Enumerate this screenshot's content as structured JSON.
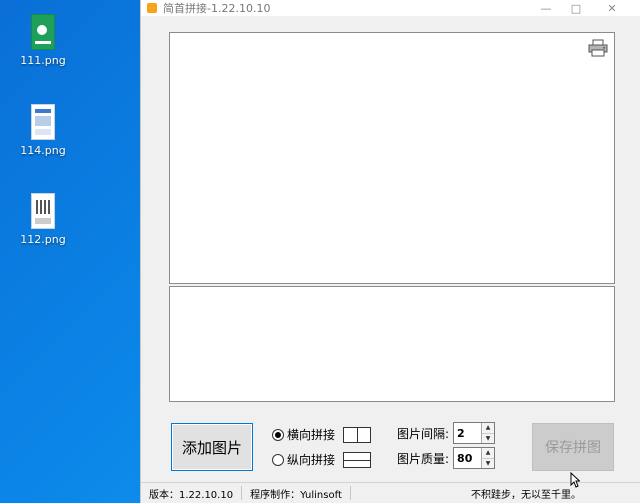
{
  "desktop": {
    "icons": [
      {
        "label": "111.png"
      },
      {
        "label": "114.png"
      },
      {
        "label": "112.png"
      }
    ]
  },
  "window": {
    "title": "简首拼接-1.22.10.10",
    "controls": {
      "minimize": "—",
      "maximize": "□",
      "close": "✕"
    }
  },
  "toolbar": {
    "add_label": "添加图片",
    "save_label": "保存拼图",
    "horizontal_label": "横向拼接",
    "vertical_label": "纵向拼接",
    "spacing_label": "图片间隔:",
    "spacing_value": "2",
    "quality_label": "图片质量:",
    "quality_value": "80"
  },
  "status": {
    "version": "版本：1.22.10.10",
    "author": "程序制作：Yulinsoft",
    "motto": "不积跬步，无以至千里。"
  },
  "icons": {
    "printer": "printer-icon",
    "app": "app-icon"
  }
}
